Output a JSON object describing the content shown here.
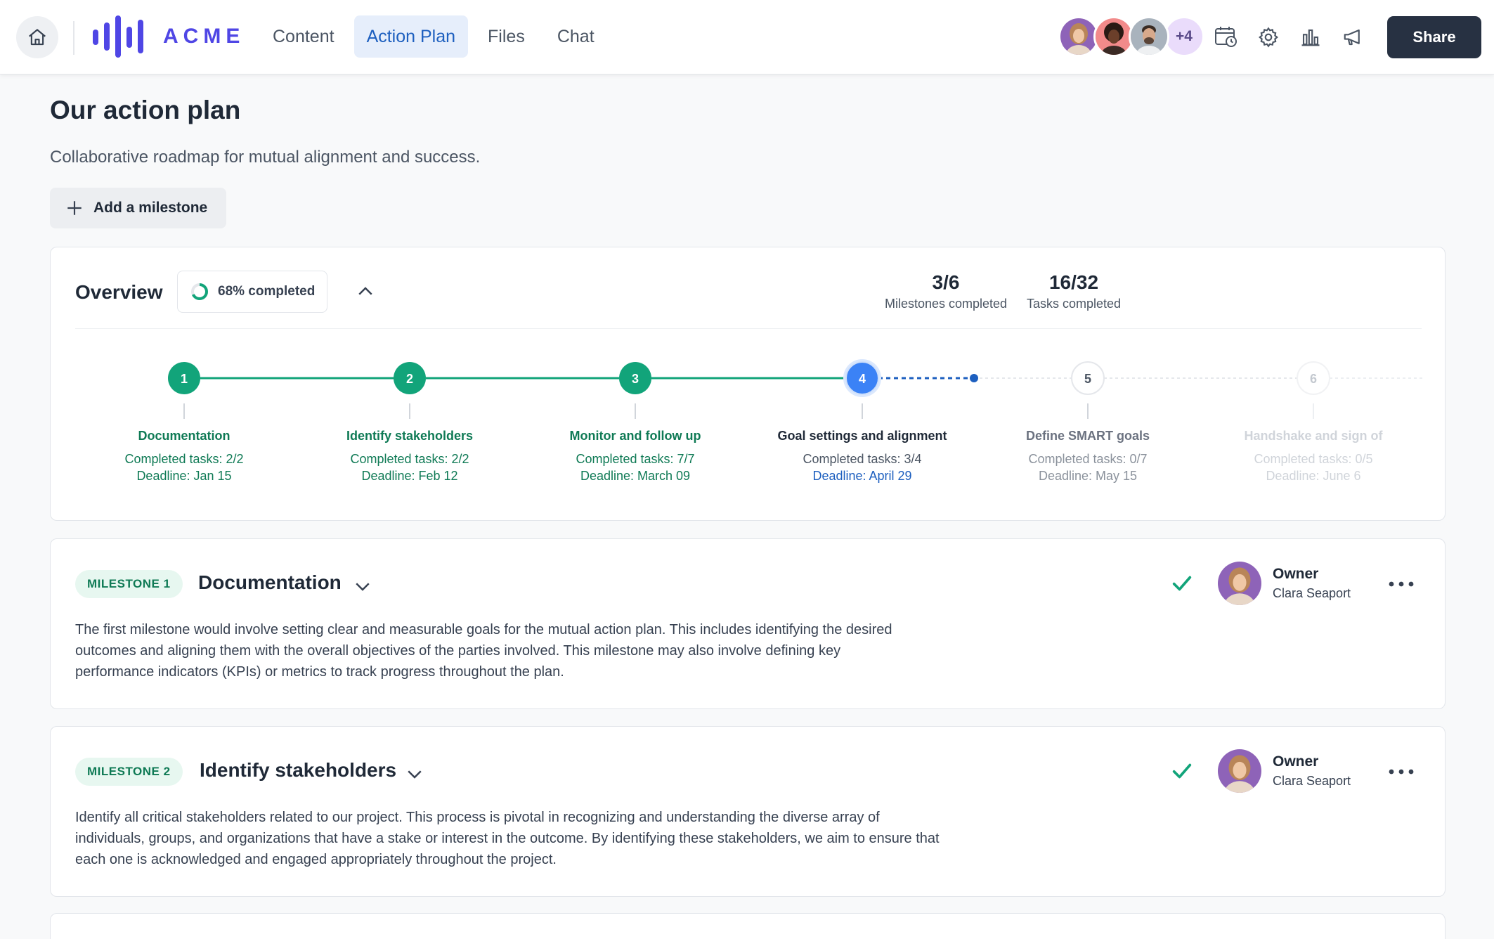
{
  "brand": {
    "logo_text": "ACME"
  },
  "nav": {
    "tabs": [
      {
        "label": "Content",
        "active": false
      },
      {
        "label": "Action Plan",
        "active": true
      },
      {
        "label": "Files",
        "active": false
      },
      {
        "label": "Chat",
        "active": false
      }
    ]
  },
  "header": {
    "avatars": [
      "collaborator-1",
      "collaborator-2",
      "collaborator-3"
    ],
    "more_count": "+4",
    "icons": [
      "calendar-clock-icon",
      "gear-icon",
      "bar-chart-icon",
      "megaphone-icon"
    ],
    "share_label": "Share"
  },
  "page": {
    "title": "Our action plan",
    "subtitle": "Collaborative roadmap for mutual alignment and success.",
    "add_milestone_label": "Add a milestone"
  },
  "overview": {
    "title": "Overview",
    "progress_label": "68% completed",
    "progress_fraction": 0.68,
    "stats": [
      {
        "value": "3/6",
        "label": "Milestones completed"
      },
      {
        "value": "16/32",
        "label": "Tasks completed"
      }
    ],
    "steps": [
      {
        "number": "1",
        "title": "Documentation",
        "tasks": "Completed tasks: 2/2",
        "deadline": "Deadline: Jan 15",
        "state": "done"
      },
      {
        "number": "2",
        "title": "Identify stakeholders",
        "tasks": "Completed tasks: 2/2",
        "deadline": "Deadline: Feb 12",
        "state": "done"
      },
      {
        "number": "3",
        "title": "Monitor and follow up",
        "tasks": "Completed tasks: 7/7",
        "deadline": "Deadline: March 09",
        "state": "done"
      },
      {
        "number": "4",
        "title": "Goal settings and alignment",
        "tasks": "Completed tasks: 3/4",
        "deadline": "Deadline: April 29",
        "state": "current"
      },
      {
        "number": "5",
        "title": "Define SMART goals",
        "tasks": "Completed tasks: 0/7",
        "deadline": "Deadline: May 15",
        "state": "upcoming"
      },
      {
        "number": "6",
        "title": "Handshake and sign of",
        "tasks": "Completed tasks: 0/5",
        "deadline": "Deadline: June 6",
        "state": "faded"
      }
    ]
  },
  "milestones": [
    {
      "badge": "MILESTONE 1",
      "title": "Documentation",
      "description": "The first milestone would involve setting clear and measurable goals for the mutual action plan. This includes identifying the desired outcomes and aligning them with the overall objectives of the parties involved. This milestone may also involve defining key performance indicators (KPIs) or metrics to track progress throughout the plan.",
      "owner_label": "Owner",
      "owner_name": "Clara Seaport",
      "completed": true
    },
    {
      "badge": "MILESTONE 2",
      "title": "Identify stakeholders",
      "description": "Identify all critical stakeholders related to our project. This process is pivotal in recognizing and understanding the diverse array of individuals, groups, and organizations that have a stake or interest in the outcome. By identifying these stakeholders, we aim to ensure that each one is acknowledged and engaged appropriately throughout the project.",
      "owner_label": "Owner",
      "owner_name": "Clara Seaport",
      "completed": true
    }
  ],
  "colors": {
    "done": "#12a47a",
    "current": "#3b82f6",
    "nav_active_bg": "#e6eefb",
    "share_bg": "#273142",
    "brand": "#4f46e5"
  }
}
